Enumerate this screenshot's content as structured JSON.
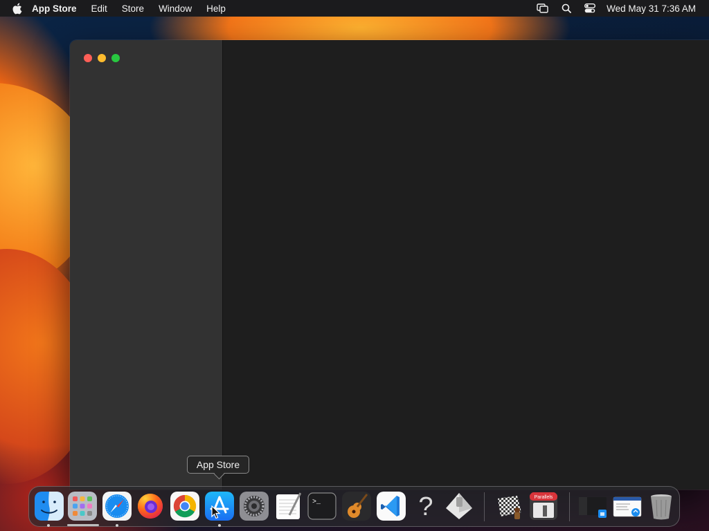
{
  "menubar": {
    "app_name": "App Store",
    "items": [
      "Edit",
      "Store",
      "Window",
      "Help"
    ],
    "clock": "Wed May 31  7:36 AM",
    "icons": [
      "apple-icon",
      "screen-mirroring-icon",
      "spotlight-search-icon",
      "control-center-icon"
    ]
  },
  "window": {
    "traffic_lights": [
      "close",
      "minimize",
      "maximize"
    ],
    "colors": {
      "close": "#fe5f57",
      "minimize": "#febc2e",
      "maximize": "#28c840"
    }
  },
  "tooltip": {
    "label": "App Store"
  },
  "dock": {
    "apps": [
      {
        "name": "finder-icon",
        "running": true
      },
      {
        "name": "launchpad-icon",
        "running": false
      },
      {
        "name": "safari-icon",
        "running": true
      },
      {
        "name": "firefox-icon",
        "running": false
      },
      {
        "name": "chrome-icon",
        "running": false
      },
      {
        "name": "app-store-icon",
        "running": true
      },
      {
        "name": "system-preferences-icon",
        "running": false
      },
      {
        "name": "textedit-icon",
        "running": false
      },
      {
        "name": "terminal-icon",
        "running": false
      },
      {
        "name": "garageband-icon",
        "running": false
      },
      {
        "name": "vscode-icon",
        "running": false
      },
      {
        "name": "help-icon",
        "running": false
      },
      {
        "name": "script-editor-icon",
        "running": false
      },
      {
        "name": "chess-icon",
        "running": false
      },
      {
        "name": "parallels-icon",
        "running": false
      },
      {
        "name": "minimized-window-icon",
        "running": false
      },
      {
        "name": "downloads-stack-icon",
        "running": false
      },
      {
        "name": "trash-icon",
        "running": false
      }
    ],
    "parallels_label": "Parallels"
  }
}
